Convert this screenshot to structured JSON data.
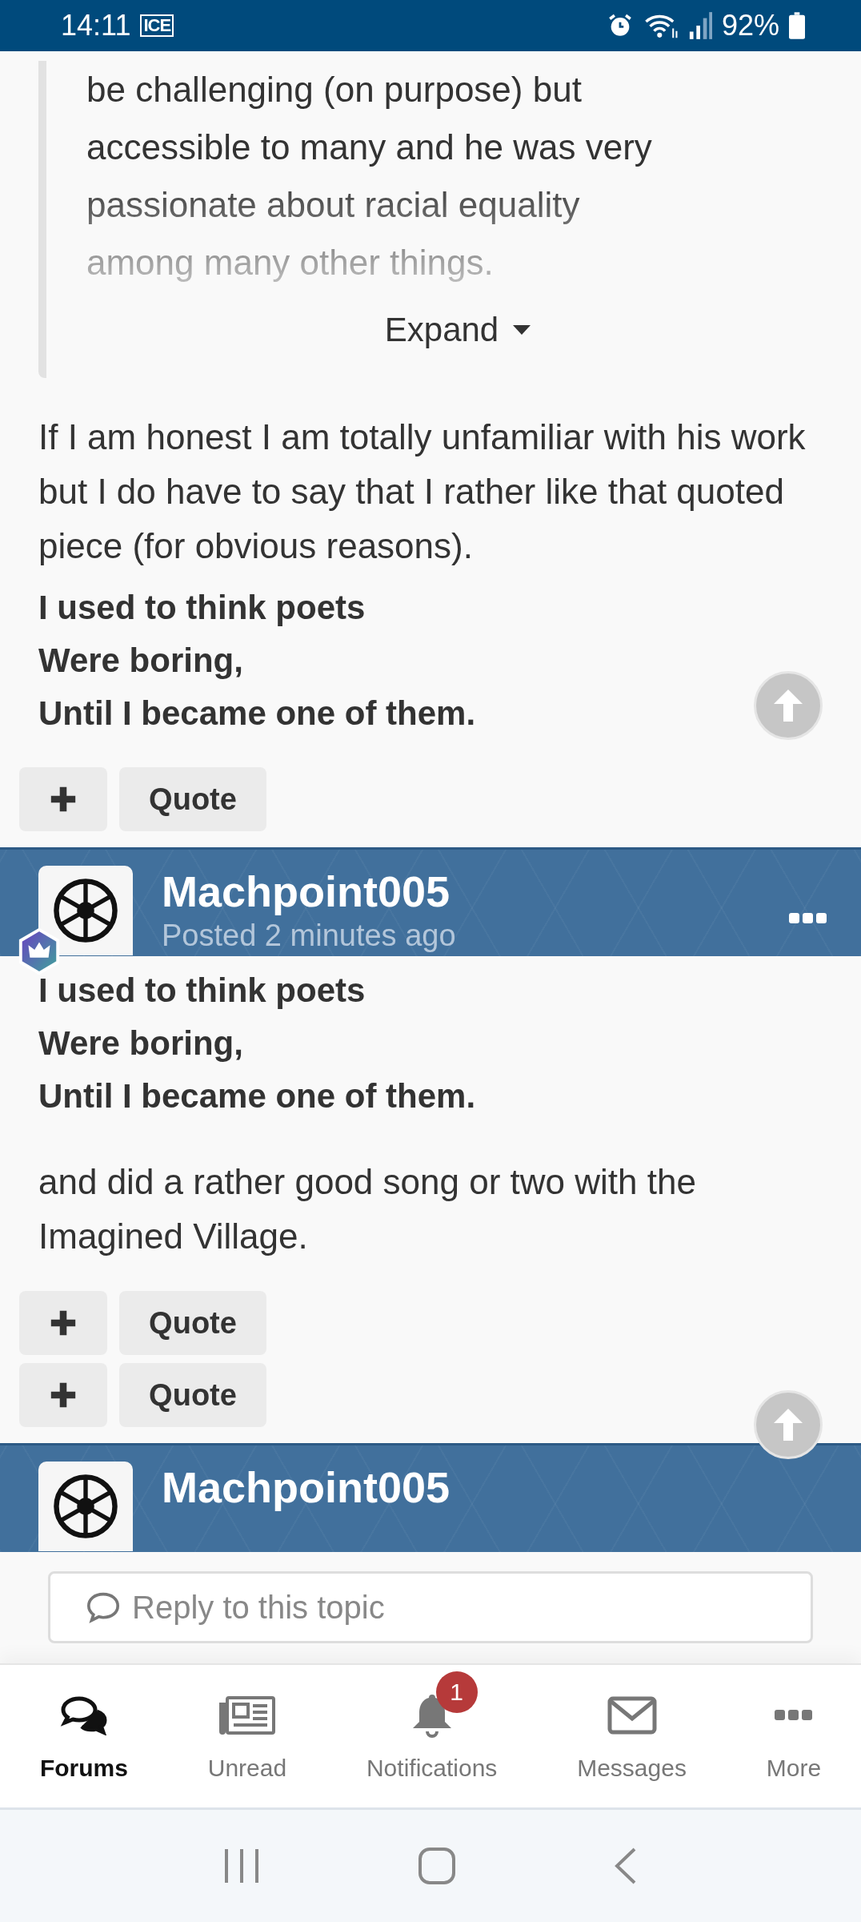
{
  "status_bar": {
    "time": "14:11",
    "carrier": "ICE",
    "battery": "92%"
  },
  "quote": {
    "text": "be challenging (on purpose) but accessible to many and he was very passionate about racial equality among many other things.",
    "expand_label": "Expand"
  },
  "blocks": [
    {
      "kind": "paragraph",
      "text": "If I am honest I am totally unfamiliar with his work but I do have to say that I rather like that quoted piece (for obvious reasons)."
    },
    {
      "kind": "signature",
      "lines": [
        "I used to think poets",
        "Were boring,",
        "Until I became one of them."
      ],
      "scroll_top_button": true
    },
    {
      "kind": "actions",
      "buttons": [
        "Quote"
      ],
      "scroll_top_button": false
    },
    {
      "kind": "author_header",
      "author": "Machpoint005",
      "posted": "Posted 2 minutes ago",
      "badge": true,
      "menu": true
    },
    {
      "kind": "signature",
      "lines": [
        "I used to think poets",
        "Were boring,",
        "Until I became one of them."
      ],
      "scroll_top_button": false
    },
    {
      "kind": "paragraph",
      "text": "and did a rather good song or two with the Imagined Village."
    },
    {
      "kind": "actions",
      "buttons": [
        "Quote",
        "Quote"
      ],
      "scroll_top_button": true
    },
    {
      "kind": "author_header",
      "author": "Machpoint005",
      "badge": false,
      "menu": false
    }
  ],
  "reply": {
    "placeholder": "Reply to this topic"
  },
  "bottom_nav": [
    {
      "label": "Forums",
      "selected": true
    },
    {
      "label": "Unread",
      "selected": false
    },
    {
      "label": "Notifications",
      "selected": false,
      "badge": "1"
    },
    {
      "label": "Messages",
      "selected": false
    },
    {
      "label": "More",
      "selected": false
    }
  ]
}
